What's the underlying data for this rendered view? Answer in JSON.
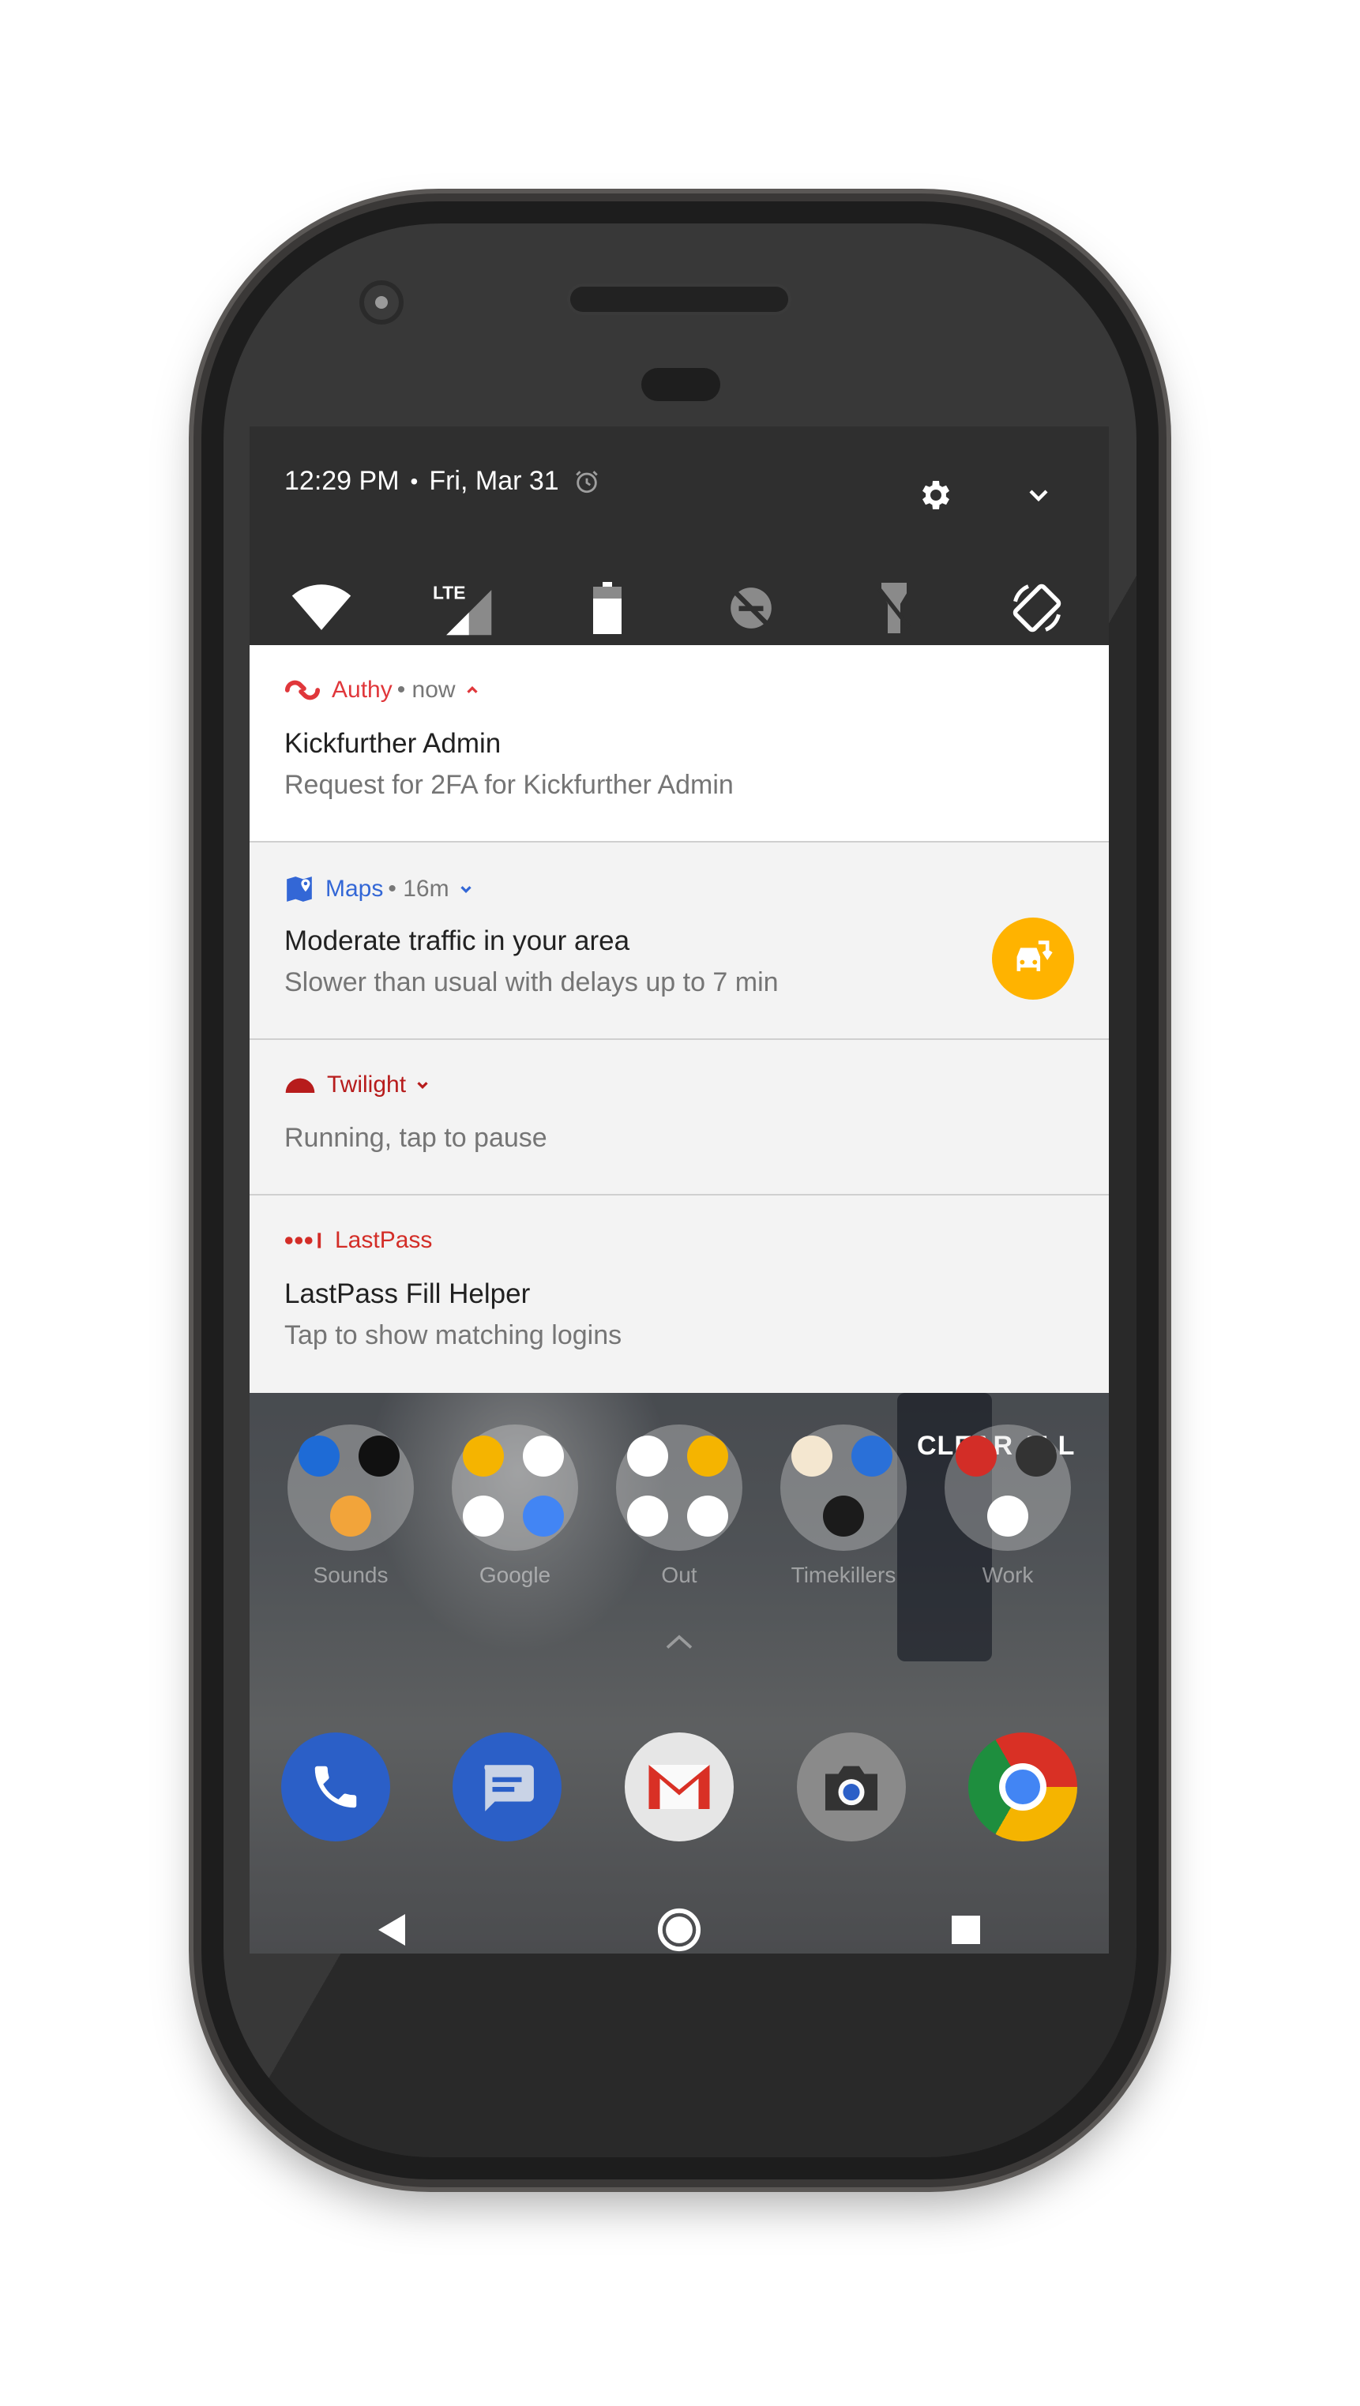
{
  "status_bar": {
    "time": "12:29 PM",
    "separator": "•",
    "date": "Fri, Mar 31"
  },
  "quick_settings": {
    "tiles": [
      {
        "name": "wifi",
        "icon": "wifi-icon"
      },
      {
        "name": "cellular",
        "icon": "lte-signal-icon",
        "label": "LTE"
      },
      {
        "name": "battery",
        "icon": "battery-icon"
      },
      {
        "name": "do-not-disturb",
        "icon": "dnd-off-icon"
      },
      {
        "name": "flashlight",
        "icon": "flashlight-off-icon"
      },
      {
        "name": "auto-rotate",
        "icon": "auto-rotate-icon"
      }
    ]
  },
  "notifications": [
    {
      "app": "Authy",
      "meta": "• now",
      "title": "Kickfurther Admin",
      "body": "Request for 2FA for Kickfurther Admin",
      "accent": "#e0373b",
      "expanded": true
    },
    {
      "app": "Maps",
      "meta": "• 16m",
      "title": "Moderate traffic in your area",
      "body": "Slower than usual with delays up to 7 min",
      "accent": "#3367d6",
      "action_icon": "car-traffic-icon"
    },
    {
      "app": "Twilight",
      "meta": "",
      "title": "",
      "body": "Running, tap to pause",
      "accent": "#b71c1c"
    },
    {
      "app": "LastPass",
      "meta": "",
      "title": "LastPass Fill Helper",
      "body": "Tap to show matching logins",
      "accent": "#d32d27"
    }
  ],
  "home": {
    "clear_all": "CLEAR ALL",
    "folders": [
      {
        "label": "Sounds"
      },
      {
        "label": "Google"
      },
      {
        "label": "Out"
      },
      {
        "label": "Timekillers"
      },
      {
        "label": "Work"
      }
    ],
    "dock": [
      {
        "name": "phone",
        "icon": "phone-icon"
      },
      {
        "name": "messages",
        "icon": "messages-icon"
      },
      {
        "name": "gmail",
        "icon": "gmail-icon"
      },
      {
        "name": "camera",
        "icon": "camera-icon"
      },
      {
        "name": "chrome",
        "icon": "chrome-icon"
      }
    ]
  },
  "navigation": [
    "back",
    "home",
    "recents"
  ]
}
